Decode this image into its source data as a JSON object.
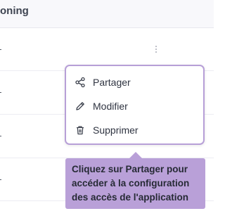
{
  "table": {
    "header_label": "oning"
  },
  "menu": {
    "items": [
      {
        "label": "Partager",
        "icon": "share-icon"
      },
      {
        "label": "Modifier",
        "icon": "pencil-icon"
      },
      {
        "label": "Supprimer",
        "icon": "trash-icon"
      }
    ]
  },
  "tooltip": {
    "text": "Cliquez sur Partager pour accéder à la configuration des accès de l'application"
  },
  "colors": {
    "accent": "#b79fd7",
    "tooltip_bg": "#b9a0d8"
  }
}
